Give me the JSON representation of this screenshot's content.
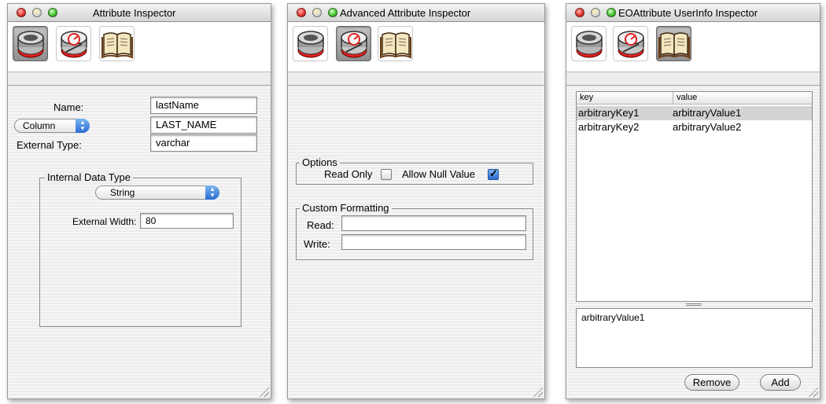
{
  "windows": [
    {
      "title": "Attribute Inspector",
      "toolbar": [
        {
          "icon": "attribute-inspector-icon",
          "selected": true
        },
        {
          "icon": "advanced-inspector-icon",
          "selected": false
        },
        {
          "icon": "userinfo-book-icon",
          "selected": false
        }
      ],
      "name_label": "Name:",
      "name_value": "lastName",
      "column_popup": "Column",
      "column_value": "LAST_NAME",
      "external_type_label": "External Type:",
      "external_type_value": "varchar",
      "internal_group_label": "Internal Data Type",
      "internal_type_popup": "String",
      "external_width_label": "External Width:",
      "external_width_value": "80"
    },
    {
      "title": "Advanced Attribute Inspector",
      "options_group_label": "Options",
      "read_only_label": "Read Only",
      "read_only_checked": false,
      "allow_null_label": "Allow Null Value",
      "allow_null_checked": true,
      "formatting_group_label": "Custom Formatting",
      "read_label": "Read:",
      "read_value": "",
      "write_label": "Write:",
      "write_value": ""
    },
    {
      "title": "EOAttribute UserInfo Inspector",
      "table_headers": [
        "key",
        "value"
      ],
      "rows": [
        {
          "key": "arbitraryKey1",
          "value": "arbitraryValue1",
          "selected": true
        },
        {
          "key": "arbitraryKey2",
          "value": "arbitraryValue2",
          "selected": false
        }
      ],
      "detail_text": "arbitraryValue1",
      "remove_button": "Remove",
      "add_button": "Add"
    }
  ],
  "colors": {
    "close_red": "#e0302a",
    "zoom_green": "#3fbf2d",
    "aqua_blue": "#2a6bd1",
    "selected_row": "#d4d4d4"
  }
}
